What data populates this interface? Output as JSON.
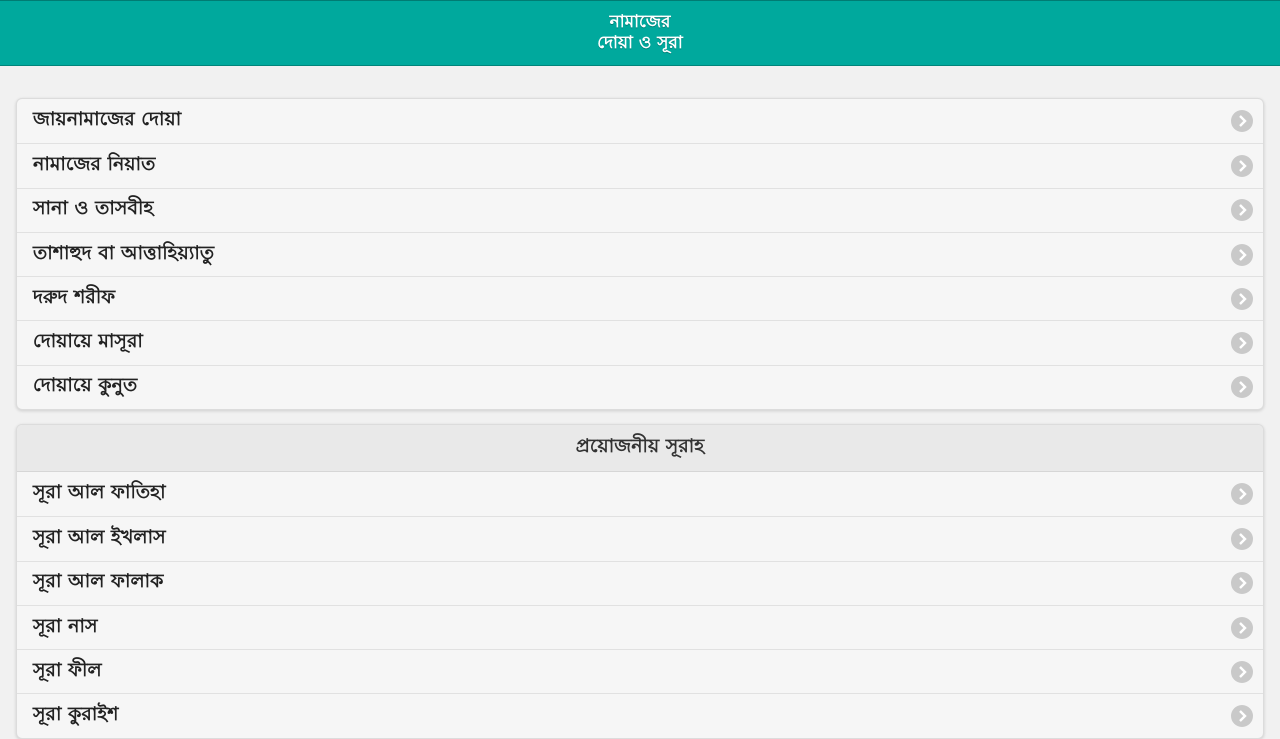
{
  "header": {
    "title_line1": "নামাজের",
    "title_line2": "দোয়া ও সূরা"
  },
  "dua_list": {
    "items": [
      {
        "label": "জায়নামাজের দোয়া"
      },
      {
        "label": "নামাজের নিয়াত"
      },
      {
        "label": "সানা ও তাসবীহ"
      },
      {
        "label": "তাশাহুদ বা আত্তাহিয়্যাতু"
      },
      {
        "label": "দরুদ শরীফ"
      },
      {
        "label": "দোয়ায়ে মাসূরা"
      },
      {
        "label": "দোয়ায়ে কুনুত"
      }
    ]
  },
  "surah_list": {
    "heading": "প্রয়োজনীয় সূরাহ",
    "items": [
      {
        "label": "সূরা আল ফাতিহা"
      },
      {
        "label": "সূরা আল ইখলাস"
      },
      {
        "label": "সূরা আল ফালাক"
      },
      {
        "label": "সূরা নাস"
      },
      {
        "label": "সূরা ফীল"
      },
      {
        "label": "সূরা কুরাইশ"
      }
    ]
  },
  "icons": {
    "row_arrow": "chevron-right-icon"
  },
  "colors": {
    "header_bg": "#00a99d",
    "page_bg": "#f1f1f1",
    "arrow_bg": "#c9c9c9"
  }
}
